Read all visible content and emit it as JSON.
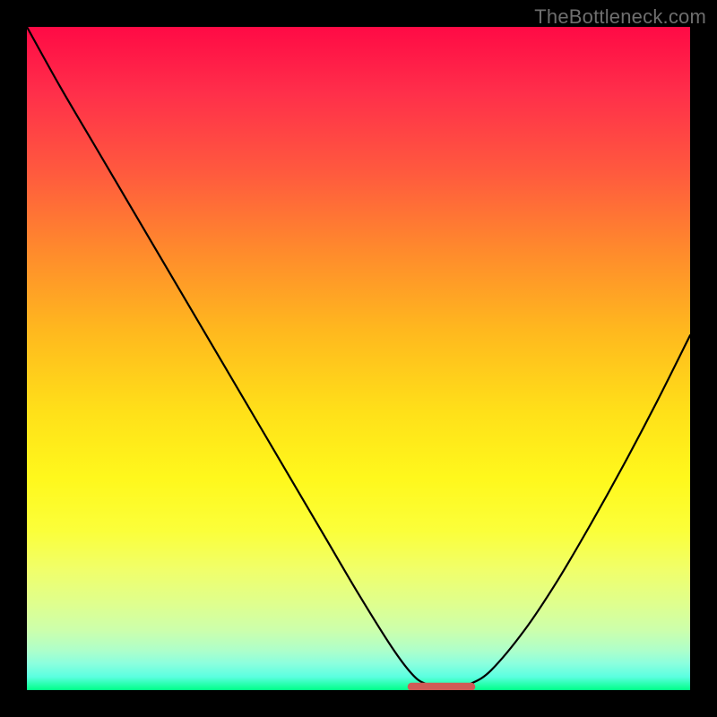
{
  "watermark": "TheBottleneck.com",
  "plot": {
    "background_gradient_stops": [
      {
        "pos": 0,
        "color": "#ff0a45"
      },
      {
        "pos": 10,
        "color": "#ff2f4a"
      },
      {
        "pos": 22,
        "color": "#ff5a3e"
      },
      {
        "pos": 34,
        "color": "#ff8b2c"
      },
      {
        "pos": 46,
        "color": "#ffb91e"
      },
      {
        "pos": 58,
        "color": "#ffe019"
      },
      {
        "pos": 68,
        "color": "#fff81c"
      },
      {
        "pos": 76,
        "color": "#fbff3a"
      },
      {
        "pos": 82,
        "color": "#f0ff6b"
      },
      {
        "pos": 87,
        "color": "#dfff8e"
      },
      {
        "pos": 91,
        "color": "#ccffac"
      },
      {
        "pos": 94,
        "color": "#aeffca"
      },
      {
        "pos": 96,
        "color": "#8bffde"
      },
      {
        "pos": 98,
        "color": "#5bffe0"
      },
      {
        "pos": 100,
        "color": "#00ff88"
      }
    ],
    "frame_color": "#000000",
    "curve_color": "#000000",
    "marker_color": "#cf5b56"
  },
  "chart_data": {
    "type": "line",
    "title": "",
    "xlabel": "",
    "ylabel": "",
    "xlim": [
      0,
      100
    ],
    "ylim": [
      0,
      100
    ],
    "series": [
      {
        "name": "bottleneck-curve",
        "x": [
          0,
          5,
          10,
          15,
          20,
          25,
          30,
          35,
          40,
          45,
          50,
          55,
          58,
          60,
          63,
          65,
          67,
          70,
          75,
          80,
          85,
          90,
          95,
          100
        ],
        "values": [
          100,
          91,
          82.5,
          74,
          65.5,
          57,
          48.5,
          40,
          31.5,
          23,
          14.5,
          6.5,
          2.5,
          1.0,
          0.5,
          0.5,
          1.0,
          3.0,
          9.0,
          16.5,
          25.0,
          34.0,
          43.5,
          53.5
        ]
      }
    ],
    "flat_valley_marker": {
      "name": "optimal-range",
      "x_start": 58,
      "x_end": 67,
      "y": 0.5,
      "color": "#cf5b56"
    }
  }
}
